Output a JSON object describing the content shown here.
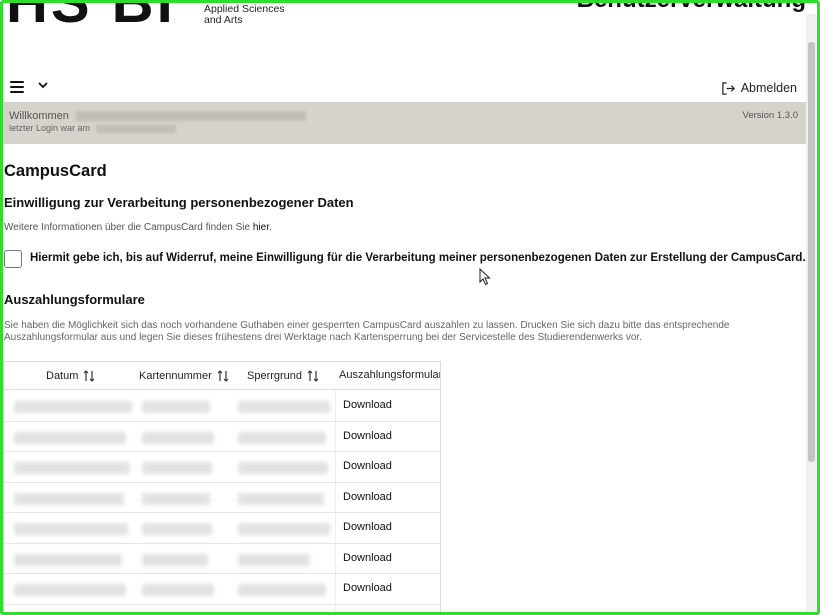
{
  "header": {
    "logo_text": "HS BI",
    "logo_sub_line1": "Applied Sciences",
    "logo_sub_line2": "and Arts",
    "app_title": "Benutzerverwaltung"
  },
  "topbar": {
    "menu_icon": "hamburger-icon",
    "chevron_icon": "chevron-down-icon",
    "logout_label": "Abmelden",
    "logout_icon": "logout-icon"
  },
  "welcome": {
    "greeting": "Willkommen",
    "last_login": "letzter Login war am",
    "version": "Version 1.3.0"
  },
  "page": {
    "title": "CampusCard",
    "consent_heading": "Einwilligung zur Verarbeitung personenbezogener Daten",
    "info_text": "Weitere Informationen über die CampusCard finden Sie ",
    "info_link": "hier",
    "info_end": ".",
    "consent_text": "Hiermit gebe ich, bis auf Widerruf, meine Einwilligung für die Verarbeitung meiner personenbezogenen Daten zur Erstellung der CampusCard.",
    "forms_heading": "Auszahlungsformulare",
    "forms_desc": "Sie haben die Möglichkeit sich das noch vorhandene Guthaben einer gesperrten CampusCard auszahlen zu lassen. Drucken Sie sich dazu bitte das entsprechende Auszahlungsformular aus und legen Sie dieses frühestens drei Werktage nach Kartensperrung bei der Servicestelle des Studierendenwerks vor."
  },
  "table": {
    "columns": [
      "Datum",
      "Kartennummer",
      "Sperrgrund",
      "Auszahlungsformular"
    ],
    "rows": [
      {
        "download": "Download"
      },
      {
        "download": "Download"
      },
      {
        "download": "Download"
      },
      {
        "download": "Download"
      },
      {
        "download": "Download"
      },
      {
        "download": "Download"
      },
      {
        "download": "Download"
      }
    ]
  },
  "colors": {
    "welcome_bg": "#d6d3cc",
    "frame": "#2fdc2f"
  }
}
